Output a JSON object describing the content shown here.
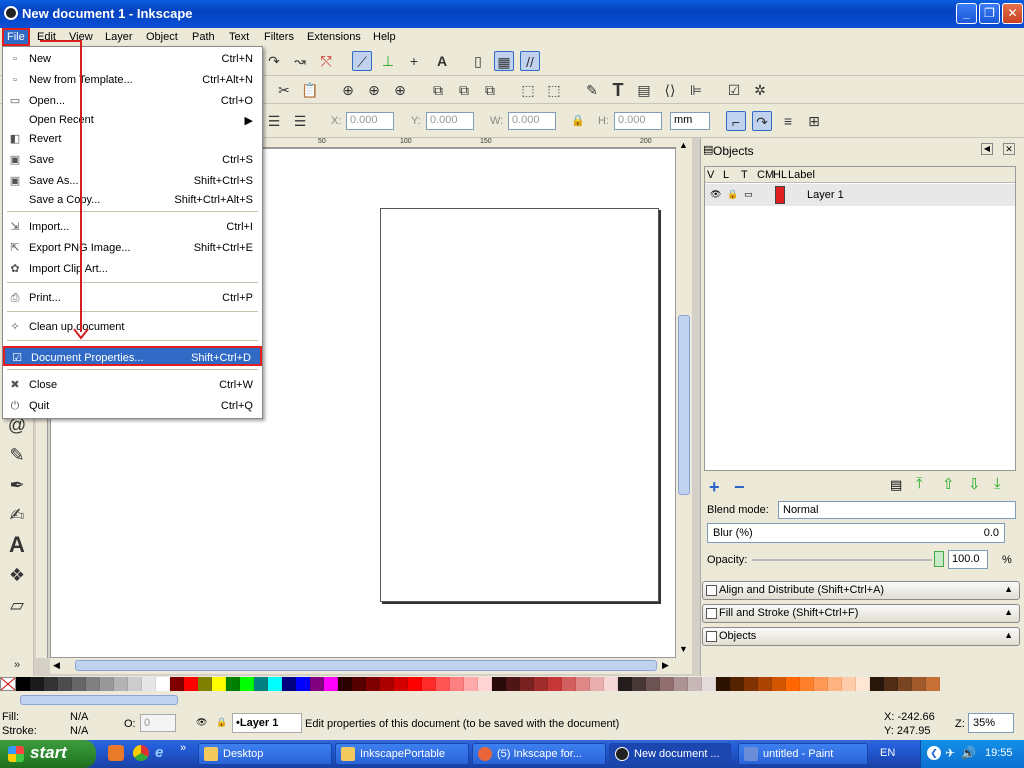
{
  "window": {
    "title": "New document 1 - Inkscape",
    "controls": {
      "minimize": "_",
      "maximize": "❐",
      "close": "✕"
    }
  },
  "menubar": {
    "items": [
      "File",
      "Edit",
      "View",
      "Layer",
      "Object",
      "Path",
      "Text",
      "Filters",
      "Extensions",
      "Help"
    ],
    "active": "File"
  },
  "file_menu": {
    "items": [
      {
        "label": "New",
        "shortcut": "Ctrl+N",
        "icon": "new-doc-icon"
      },
      {
        "label": "New from Template...",
        "shortcut": "Ctrl+Alt+N",
        "icon": "template-icon"
      },
      {
        "label": "Open...",
        "shortcut": "Ctrl+O",
        "icon": "open-folder-icon"
      },
      {
        "label": "Open Recent",
        "shortcut": "▶",
        "icon": ""
      },
      {
        "label": "Revert",
        "shortcut": "",
        "icon": "revert-icon"
      },
      {
        "label": "Save",
        "shortcut": "Ctrl+S",
        "icon": "save-icon"
      },
      {
        "label": "Save As...",
        "shortcut": "Shift+Ctrl+S",
        "icon": "save-as-icon"
      },
      {
        "label": "Save a Copy...",
        "shortcut": "Shift+Ctrl+Alt+S",
        "icon": ""
      },
      {
        "label": "Import...",
        "shortcut": "Ctrl+I",
        "icon": "import-icon"
      },
      {
        "label": "Export PNG Image...",
        "shortcut": "Shift+Ctrl+E",
        "icon": "export-icon"
      },
      {
        "label": "Import Clip Art...",
        "shortcut": "",
        "icon": "clipart-icon"
      },
      {
        "label": "Print...",
        "shortcut": "Ctrl+P",
        "icon": "print-icon"
      },
      {
        "label": "Clean up document",
        "shortcut": "",
        "icon": "cleanup-icon"
      },
      {
        "label": "Document Properties...",
        "shortcut": "Shift+Ctrl+D",
        "icon": "doc-properties-icon"
      },
      {
        "label": "Close",
        "shortcut": "Ctrl+W",
        "icon": "close-doc-icon"
      },
      {
        "label": "Quit",
        "shortcut": "Ctrl+Q",
        "icon": "quit-icon"
      }
    ],
    "highlighted": "Document Properties..."
  },
  "toolbar2": {
    "x_label": "X:",
    "x_value": "0.000",
    "y_label": "Y:",
    "y_value": "0.000",
    "w_label": "W:",
    "w_value": "0.000",
    "h_label": "H:",
    "h_value": "0.000",
    "unit": "mm"
  },
  "ruler": {
    "ticks": [
      "50",
      "100",
      "150",
      "200"
    ]
  },
  "objects_panel": {
    "title": "Objects",
    "columns": [
      "V",
      "L",
      "T",
      "CM",
      "HL",
      "Label"
    ],
    "layers": [
      {
        "label": "Layer 1"
      }
    ],
    "blend_mode_label": "Blend mode:",
    "blend_mode_value": "Normal",
    "blur_label": "Blur (%)",
    "blur_value": "0.0",
    "opacity_label": "Opacity:",
    "opacity_value": "100.0",
    "opacity_unit": "%"
  },
  "collapsed_panels": [
    "Align and Distribute (Shift+Ctrl+A)",
    "Fill and Stroke (Shift+Ctrl+F)",
    "Objects"
  ],
  "palette": [
    "#000000",
    "#1a1a1a",
    "#333333",
    "#4d4d4d",
    "#666666",
    "#808080",
    "#999999",
    "#b3b3b3",
    "#cccccc",
    "#e6e6e6",
    "#ffffff",
    "#800000",
    "#ff0000",
    "#808000",
    "#ffff00",
    "#008000",
    "#00ff00",
    "#008080",
    "#00ffff",
    "#000080",
    "#0000ff",
    "#800080",
    "#ff00ff",
    "#2b0000",
    "#550000",
    "#800000",
    "#aa0000",
    "#d40000",
    "#ff0000",
    "#ff2a2a",
    "#ff5555",
    "#ff8080",
    "#ffaaaa",
    "#ffd5d5",
    "#280b0b",
    "#501616",
    "#782121",
    "#a02c2c",
    "#c83737",
    "#d35f5f",
    "#de8787",
    "#e9afaf",
    "#f4d7d7",
    "#241c1c",
    "#483737",
    "#6c5353",
    "#916f6f",
    "#ac9393",
    "#c8b7b7",
    "#e3dbdb",
    "#2b1100",
    "#552200",
    "#803300",
    "#aa4400",
    "#d45500",
    "#ff6600",
    "#ff7f2a",
    "#ff9955",
    "#ffb380",
    "#ffccaa",
    "#ffe6d5",
    "#28170b",
    "#502d16",
    "#784421",
    "#a05a2c",
    "#c87137"
  ],
  "status": {
    "fill_label": "Fill:",
    "fill_value": "N/A",
    "stroke_label": "Stroke:",
    "stroke_value": "N/A",
    "o_label": "O:",
    "o_value": "0",
    "layer_value": "•Layer 1",
    "message": "Edit properties of this document (to be saved with the document)",
    "x_coord": "X: -242.66",
    "y_coord": "Y:  247.95",
    "zoom_label": "Z:",
    "zoom_value": "35%"
  },
  "taskbar": {
    "start_label": "start",
    "buttons": [
      {
        "label": "Desktop",
        "color": "#f4c95d"
      },
      {
        "label": "InkscapePortable",
        "color": "#f4c95d"
      },
      {
        "label": "(5) Inkscape for...",
        "color": "#e8663a"
      },
      {
        "label": "New document ...",
        "color": "#222222"
      },
      {
        "label": "untitled - Paint",
        "color": "#6b8cd6"
      }
    ],
    "lang": "EN",
    "clock": "19:55"
  }
}
